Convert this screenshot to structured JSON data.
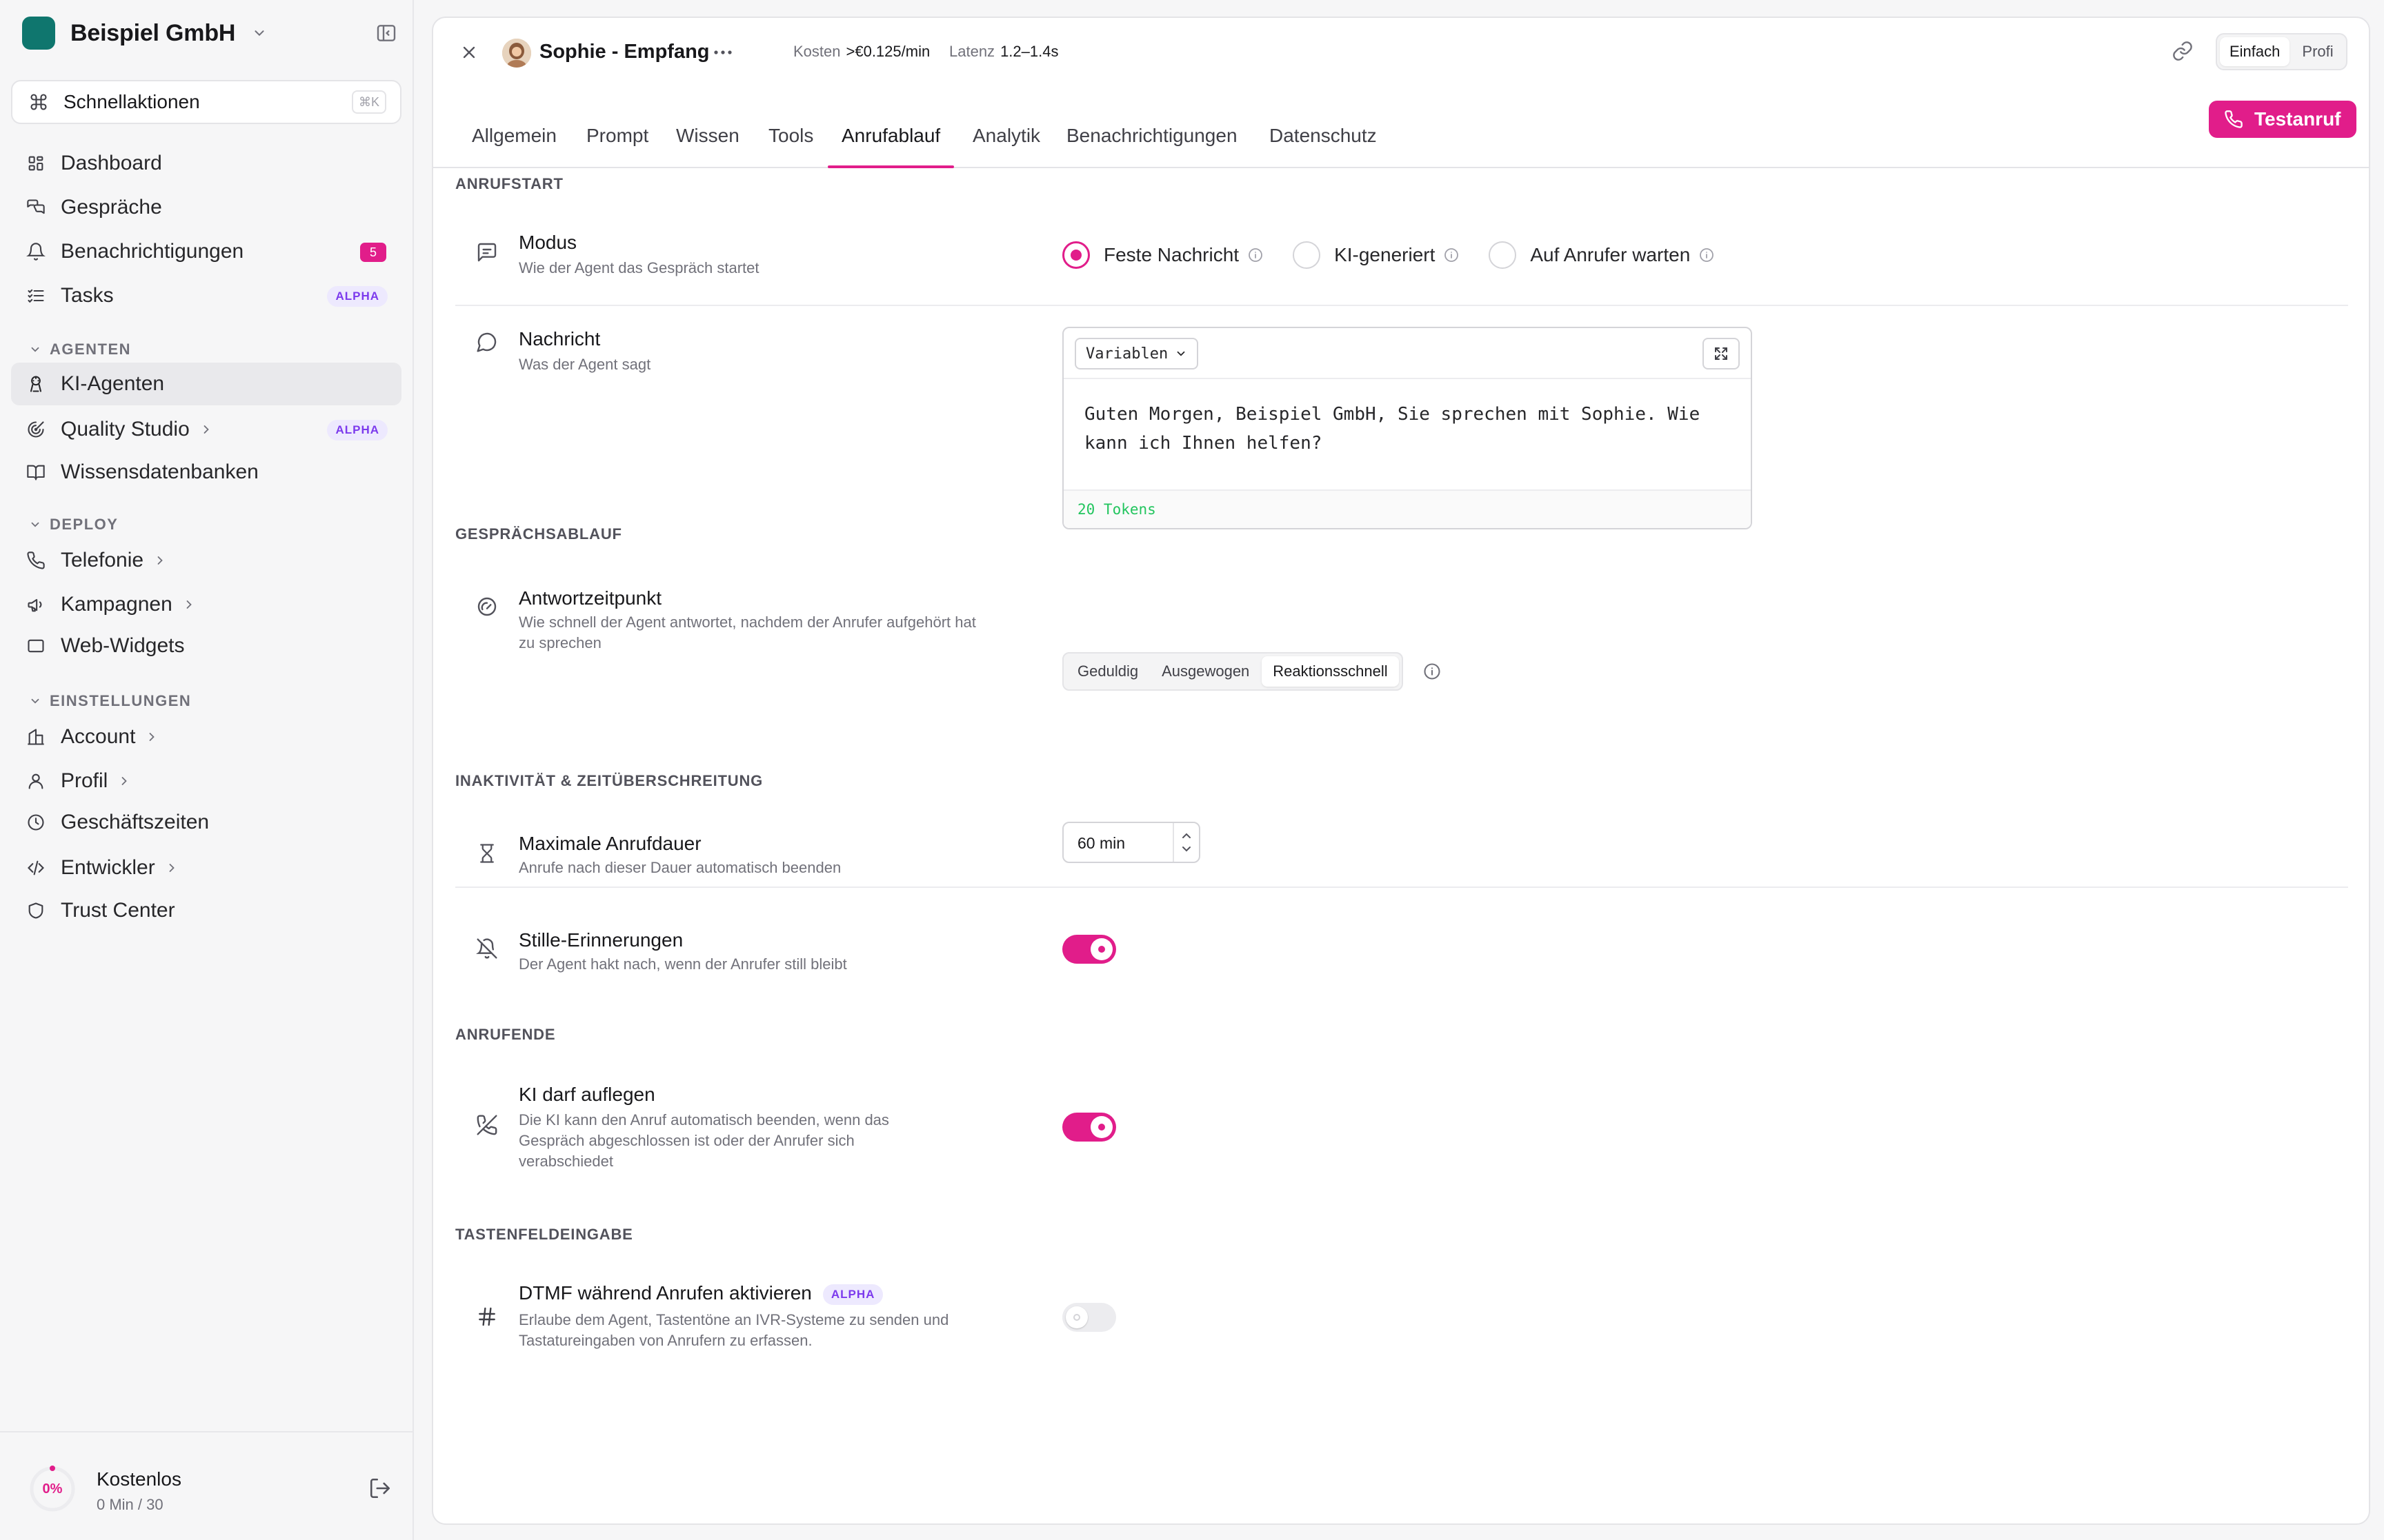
{
  "org": {
    "name": "Beispiel GmbH"
  },
  "quick_actions": {
    "label": "Schnellaktionen",
    "shortcut": "⌘K"
  },
  "nav": {
    "dashboard": "Dashboard",
    "conversations": "Gespräche",
    "notifications": "Benachrichtigungen",
    "notifications_count": "5",
    "tasks": "Tasks",
    "tasks_badge": "ALPHA",
    "section_agents": "AGENTEN",
    "ai_agents": "KI-Agenten",
    "quality_studio": "Quality Studio",
    "quality_studio_badge": "ALPHA",
    "knowledge_bases": "Wissensdatenbanken",
    "section_deploy": "DEPLOY",
    "telephony": "Telefonie",
    "campaigns": "Kampagnen",
    "web_widgets": "Web-Widgets",
    "section_settings": "EINSTELLUNGEN",
    "account": "Account",
    "profile": "Profil",
    "business_hours": "Geschäftszeiten",
    "developer": "Entwickler",
    "trust_center": "Trust Center"
  },
  "plan": {
    "usage_percent": "0%",
    "name": "Kostenlos",
    "usage": "0 Min / 30"
  },
  "agent": {
    "name": "Sophie - Empfang",
    "cost_label": "Kosten",
    "cost_value": ">€0.125/min",
    "latency_label": "Latenz",
    "latency_value": "1.2–1.4s"
  },
  "view_mode": {
    "simple": "Einfach",
    "pro": "Profi",
    "selected": "Einfach"
  },
  "tabs": [
    "Allgemein",
    "Prompt",
    "Wissen",
    "Tools",
    "Anrufablauf",
    "Analytik",
    "Benachrichtigungen",
    "Datenschutz"
  ],
  "active_tab": "Anrufablauf",
  "test_call_label": "Testanruf",
  "sections": {
    "call_start": "ANRUFSTART",
    "flow": "GESPRÄCHSABLAUF",
    "inactivity": "INAKTIVITÄT & ZEITÜBERSCHREITUNG",
    "call_end": "ANRUFENDE",
    "keypad": "TASTENFELDEINGABE"
  },
  "mode": {
    "title": "Modus",
    "desc": "Wie der Agent das Gespräch startet",
    "options": [
      "Feste Nachricht",
      "KI-generiert",
      "Auf Anrufer warten"
    ],
    "selected": "Feste Nachricht"
  },
  "message": {
    "title": "Nachricht",
    "desc": "Was der Agent sagt",
    "variables_label": "Variablen",
    "text": "Guten Morgen, Beispiel GmbH, Sie sprechen mit Sophie. Wie kann ich Ihnen helfen?",
    "tokens": "20 Tokens"
  },
  "response_timing": {
    "title": "Antwortzeitpunkt",
    "desc": "Wie schnell der Agent antwortet, nachdem der Anrufer aufgehört hat zu sprechen",
    "options": [
      "Geduldig",
      "Ausgewogen",
      "Reaktionsschnell"
    ],
    "selected": "Reaktionsschnell"
  },
  "max_duration": {
    "title": "Maximale Anrufdauer",
    "desc": "Anrufe nach dieser Dauer automatisch beenden",
    "value": "60 min"
  },
  "silence": {
    "title": "Stille-Erinnerungen",
    "desc": "Der Agent hakt nach, wenn der Anrufer still bleibt",
    "enabled": true
  },
  "hangup": {
    "title": "KI darf auflegen",
    "desc": "Die KI kann den Anruf automatisch beenden, wenn das Gespräch abgeschlossen ist oder der Anrufer sich verabschiedet",
    "enabled": true
  },
  "dtmf": {
    "title": "DTMF während Anrufen aktivieren",
    "badge": "ALPHA",
    "desc": "Erlaube dem Agent, Tastentöne an IVR-Systeme zu senden und Tastatureingaben von Anrufern zu erfassen.",
    "enabled": false
  },
  "colors": {
    "accent": "#e11d8a",
    "brand": "#0f766e",
    "alpha_badge": "#7c3aed",
    "tokens": "#22c55e"
  }
}
